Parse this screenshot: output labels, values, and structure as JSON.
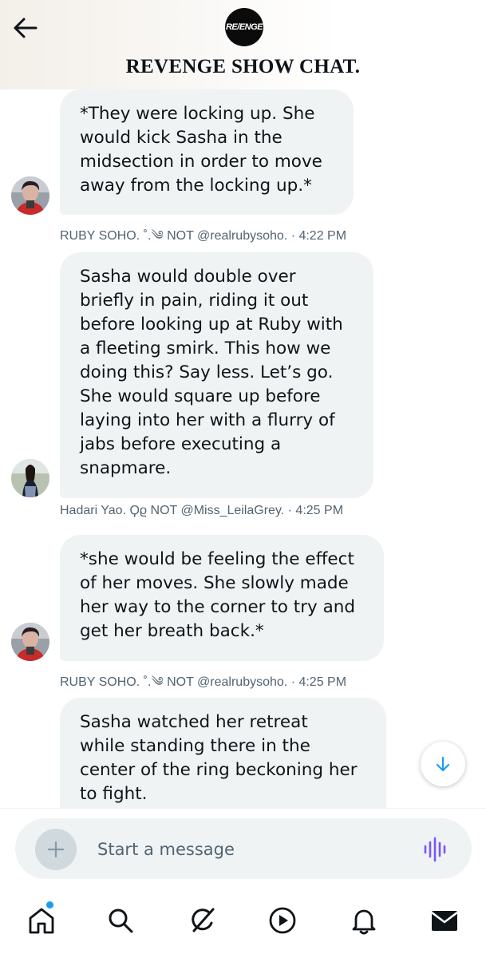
{
  "header": {
    "title": "REVENGE SHOW CHAT.",
    "logo_text": "RE/ENGE"
  },
  "messages": [
    {
      "text": "*They were locking up. She\nwould kick Sasha in the\nmidsection in order to move\naway from the locking up.*",
      "sender": "RUBY SOHO. ˚.༄ NOT @realrubysoho.",
      "time": "· 4:22 PM"
    },
    {
      "text": "Sasha would double over\nbriefly in pain, riding it out\nbefore looking up at Ruby with\na fleeting smirk. This how we\ndoing this? Say less. Let’s go.\nShe would square up before\nlaying into her with a flurry of\njabs before executing a\nsnapmare.",
      "sender": "Hadari Yao. Ϙϱ NOT @Miss_LeilaGrey.",
      "time": "· 4:25 PM"
    },
    {
      "text": "*she would be feeling the effect\nof her moves. She slowly made\nher way to the corner to try and\nget her breath back.*",
      "sender": "RUBY SOHO. ˚.༄ NOT @realrubysoho.",
      "time": "· 4:25 PM"
    },
    {
      "text": "Sasha watched her retreat\nwhile standing there in the\ncenter of the ring beckoning her\nto fight."
    }
  ],
  "composer": {
    "placeholder": "Start a message"
  },
  "icons": {
    "back": "arrow-left-icon",
    "scroll": "arrow-down-icon",
    "add": "plus-icon",
    "voice": "voice-wave-icon",
    "home": "home-icon",
    "search": "search-icon",
    "grok": "grok-icon",
    "video": "play-icon",
    "notifications": "bell-icon",
    "messages": "mail-icon"
  },
  "colors": {
    "bubble": "#eff3f4",
    "accent": "#1d9bf0",
    "voice": "#7856ff",
    "meta": "#536471"
  }
}
